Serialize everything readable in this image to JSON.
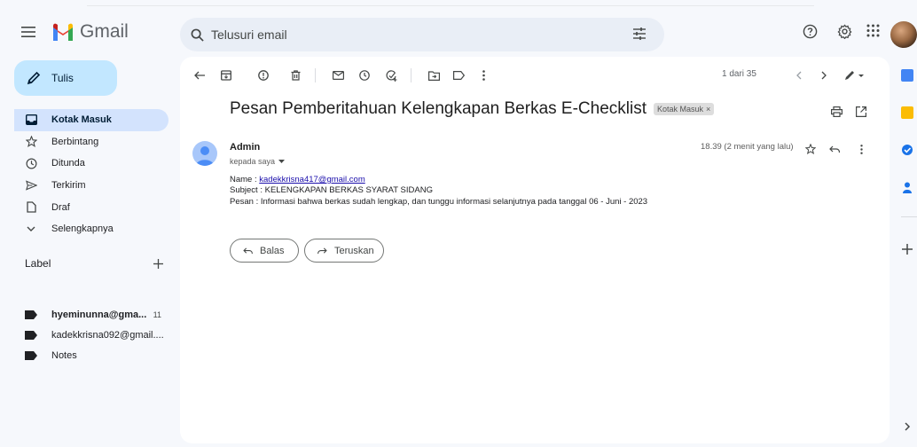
{
  "app": {
    "name": "Gmail"
  },
  "header": {
    "search_placeholder": "Telusuri email",
    "icons": [
      "menu-icon",
      "search-icon",
      "tune-icon",
      "help-icon",
      "settings-icon",
      "apps-icon",
      "account-avatar"
    ]
  },
  "sidebar": {
    "compose_label": "Tulis",
    "items": [
      {
        "label": "Kotak Masuk",
        "icon": "inbox-icon",
        "active": true
      },
      {
        "label": "Berbintang",
        "icon": "star-icon"
      },
      {
        "label": "Ditunda",
        "icon": "clock-icon"
      },
      {
        "label": "Terkirim",
        "icon": "send-icon"
      },
      {
        "label": "Draf",
        "icon": "draft-icon"
      },
      {
        "label": "Selengkapnya",
        "icon": "chevron-down-icon"
      }
    ],
    "labels_header": "Label",
    "labels": [
      {
        "label": "hyeminunna@gma...",
        "count": "11",
        "bold": true
      },
      {
        "label": "kadekkrisna092@gmail....",
        "count": ""
      },
      {
        "label": "Notes",
        "count": ""
      }
    ]
  },
  "toolbar": {
    "pager": "1 dari 35"
  },
  "email": {
    "subject": "Pesan Pemberitahuan Kelengkapan Berkas E-Checklist",
    "label_chip": "Kotak Masuk",
    "sender": "Admin",
    "to": "kepada saya",
    "time": "18.39 (2 menit yang lalu)",
    "body": {
      "name_prefix": "Name : ",
      "name_link": "kadekkrisna417@gmail.com",
      "subject_line": "Subject : KELENGKAPAN BERKAS SYARAT SIDANG",
      "message_line": "Pesan : Informasi bahwa berkas sudah lengkap, dan tunggu informasi selanjutnya pada tanggal 06 - Juni - 2023"
    },
    "reply_label": "Balas",
    "forward_label": "Teruskan"
  },
  "colors": {
    "background": "#f6f8fc",
    "compose": "#c2e7ff",
    "active_nav": "#d3e3fd",
    "search": "#e9eef6",
    "link": "#1a0dab"
  }
}
